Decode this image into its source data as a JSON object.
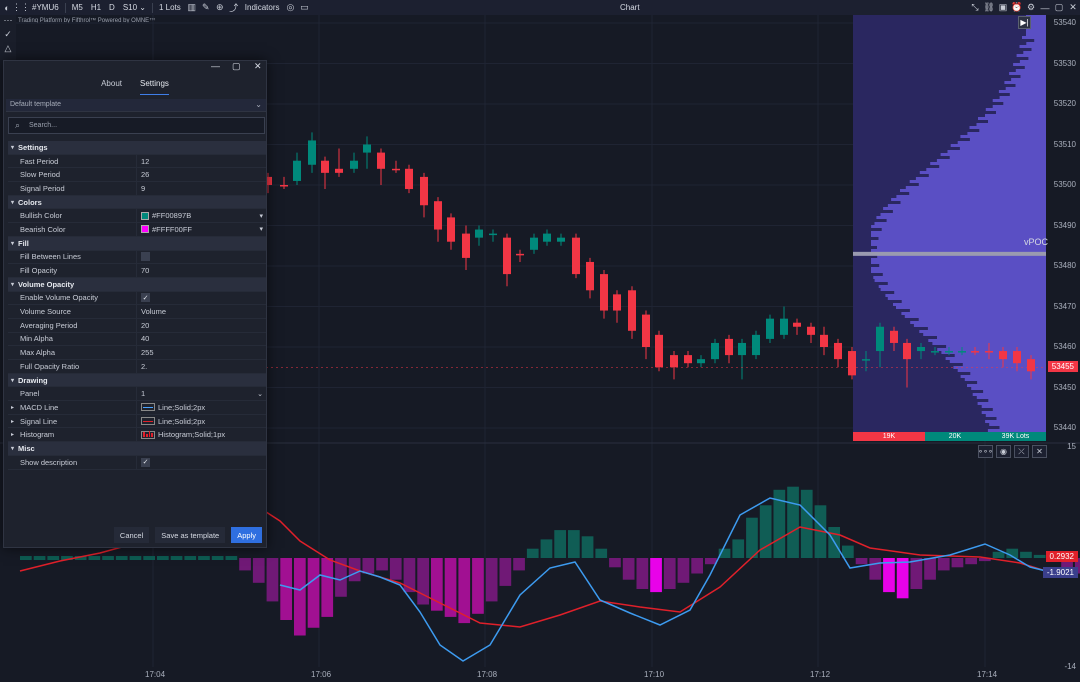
{
  "toolbar": {
    "symbol": "#YMU6",
    "timeframes": [
      "M5",
      "H1",
      "D"
    ],
    "aggregation": "S10",
    "lots": "1 Lots",
    "indicators_label": "Indicators",
    "chart_title": "Chart"
  },
  "watermark": "Trading Platform by Fifthrol™ Powered by OMNE™",
  "chart": {
    "price_axis": [
      "53540",
      "53530",
      "53520",
      "53510",
      "53500",
      "53490",
      "53480",
      "53470",
      "53460",
      "53450",
      "53440"
    ],
    "current_price": "53455",
    "vpoc_label": "vPOC",
    "profile_footer": {
      "sell": "19K",
      "buy": "20K",
      "total": "39K Lots"
    },
    "macd_axis": {
      "top": "15",
      "bottom": "-14"
    },
    "macd_tags": {
      "signal": "0.2932",
      "macd": "-1.9021"
    },
    "time_axis": [
      "17:04",
      "17:06",
      "17:08",
      "17:10",
      "17:12",
      "17:14"
    ],
    "colors": {
      "bull": "#00897B",
      "bear": "#F23645",
      "macd": "#3D9BF0",
      "signal": "#E0202A",
      "hist_bear": "#FF00FF",
      "profile": "#4A3F9E"
    }
  },
  "dialog": {
    "tabs": [
      "About",
      "Settings"
    ],
    "template": "Default template",
    "search_placeholder": "Search...",
    "sections": {
      "settings": "Settings",
      "colors": "Colors",
      "fill": "Fill",
      "volume_opacity": "Volume Opacity",
      "drawing": "Drawing",
      "misc": "Misc"
    },
    "props": {
      "fast_period": {
        "label": "Fast Period",
        "value": "12"
      },
      "slow_period": {
        "label": "Slow Period",
        "value": "26"
      },
      "signal_period": {
        "label": "Signal Period",
        "value": "9"
      },
      "bullish_color": {
        "label": "Bullish Color",
        "value": "#FF00897B"
      },
      "bearish_color": {
        "label": "Bearish Color",
        "value": "#FFFF00FF"
      },
      "fill_between": {
        "label": "Fill Between Lines"
      },
      "fill_opacity": {
        "label": "Fill Opacity",
        "value": "70"
      },
      "enable_vol_opacity": {
        "label": "Enable Volume Opacity"
      },
      "volume_source": {
        "label": "Volume Source",
        "value": "Volume"
      },
      "averaging_period": {
        "label": "Averaging Period",
        "value": "20"
      },
      "min_alpha": {
        "label": "Min Alpha",
        "value": "40"
      },
      "max_alpha": {
        "label": "Max Alpha",
        "value": "255"
      },
      "full_opacity_ratio": {
        "label": "Full Opacity Ratio",
        "value": "2."
      },
      "panel": {
        "label": "Panel",
        "value": "1"
      },
      "macd_line": {
        "label": "MACD Line",
        "value": "Line;Solid;2px"
      },
      "signal_line": {
        "label": "Signal Line",
        "value": "Line;Solid;2px"
      },
      "histogram": {
        "label": "Histogram",
        "value": "Histogram;Solid;1px"
      },
      "show_description": {
        "label": "Show description"
      }
    },
    "buttons": {
      "cancel": "Cancel",
      "save_template": "Save as template",
      "apply": "Apply"
    }
  }
}
